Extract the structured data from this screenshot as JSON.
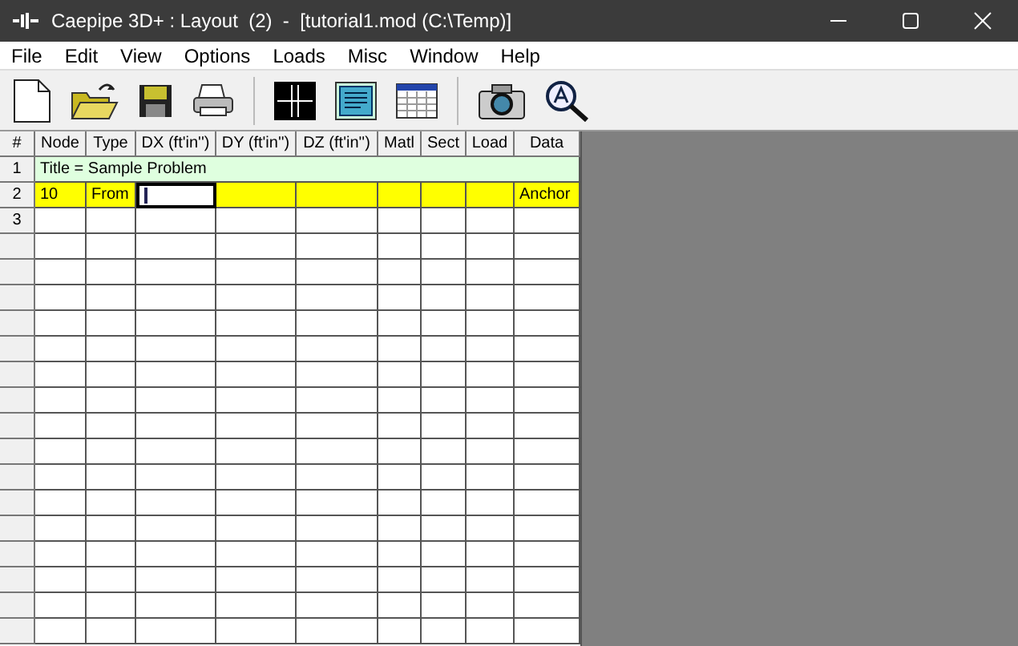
{
  "window": {
    "title": "Caepipe 3D+ : Layout  (2)  -  [tutorial1.mod (C:\\Temp)]"
  },
  "menu": [
    "File",
    "Edit",
    "View",
    "Options",
    "Loads",
    "Misc",
    "Window",
    "Help"
  ],
  "grid": {
    "columns": [
      "#",
      "Node",
      "Type",
      "DX (ft'in'')",
      "DY (ft'in'')",
      "DZ (ft'in'')",
      "Matl",
      "Sect",
      "Load",
      "Data"
    ],
    "rows": [
      {
        "number": "1",
        "kind": "title",
        "selected": false,
        "text": "Title = Sample Problem"
      },
      {
        "number": "2",
        "kind": "data",
        "selected": true,
        "cells": [
          {
            "text": "10",
            "active": false
          },
          {
            "text": "From",
            "active": false
          },
          {
            "active": true
          },
          {
            "active": false
          },
          {
            "active": false
          },
          {
            "active": false
          },
          {
            "active": false
          },
          {
            "active": false
          },
          {
            "text": "Anchor",
            "active": false
          }
        ]
      },
      {
        "number": "3",
        "kind": "data",
        "selected": false
      }
    ]
  }
}
